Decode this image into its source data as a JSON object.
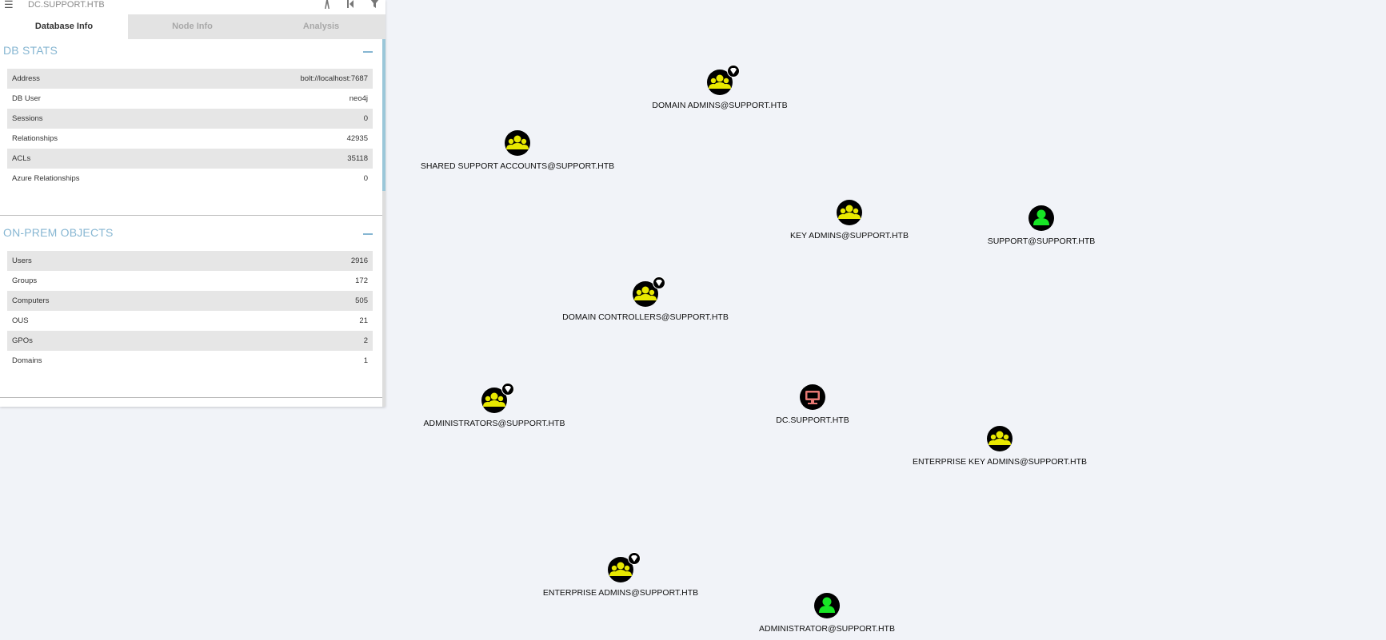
{
  "topbar": {
    "search_value": "DC.SUPPORT.HTB",
    "icons": [
      "menu-icon",
      "pathfinding-icon",
      "back-icon",
      "filter-icon"
    ]
  },
  "tabs": [
    {
      "label": "Database Info",
      "active": true
    },
    {
      "label": "Node Info",
      "active": false
    },
    {
      "label": "Analysis",
      "active": false
    }
  ],
  "db_stats": {
    "title": "DB STATS",
    "rows": [
      {
        "key": "Address",
        "value": "bolt://localhost:7687"
      },
      {
        "key": "DB User",
        "value": "neo4j"
      },
      {
        "key": "Sessions",
        "value": "0"
      },
      {
        "key": "Relationships",
        "value": "42935"
      },
      {
        "key": "ACLs",
        "value": "35118"
      },
      {
        "key": "Azure Relationships",
        "value": "0"
      }
    ]
  },
  "onprem": {
    "title": "ON-PREM OBJECTS",
    "rows": [
      {
        "key": "Users",
        "value": "2916"
      },
      {
        "key": "Groups",
        "value": "172"
      },
      {
        "key": "Computers",
        "value": "505"
      },
      {
        "key": "OUS",
        "value": "21"
      },
      {
        "key": "GPOs",
        "value": "2"
      },
      {
        "key": "Domains",
        "value": "1"
      }
    ]
  },
  "colors": {
    "accent": "#86b6d2",
    "group_icon": "#e8e800",
    "user_icon": "#17e625",
    "computer_icon": "#e67873"
  },
  "graph": {
    "nodes": [
      {
        "label": "DOMAIN ADMINS@SUPPORT.HTB",
        "type": "group",
        "highvalue": true
      },
      {
        "label": "SHARED SUPPORT ACCOUNTS@SUPPORT.HTB",
        "type": "group",
        "highvalue": false
      },
      {
        "label": "KEY ADMINS@SUPPORT.HTB",
        "type": "group",
        "highvalue": false
      },
      {
        "label": "SUPPORT@SUPPORT.HTB",
        "type": "user",
        "highvalue": false
      },
      {
        "label": "DOMAIN CONTROLLERS@SUPPORT.HTB",
        "type": "group",
        "highvalue": true
      },
      {
        "label": "ADMINISTRATORS@SUPPORT.HTB",
        "type": "group",
        "highvalue": true
      },
      {
        "label": "DC.SUPPORT.HTB",
        "type": "computer",
        "highvalue": false
      },
      {
        "label": "ENTERPRISE KEY ADMINS@SUPPORT.HTB",
        "type": "group",
        "highvalue": false
      },
      {
        "label": "ENTERPRISE ADMINS@SUPPORT.HTB",
        "type": "group",
        "highvalue": true
      },
      {
        "label": "ADMINISTRATOR@SUPPORT.HTB",
        "type": "user",
        "highvalue": false
      }
    ]
  }
}
